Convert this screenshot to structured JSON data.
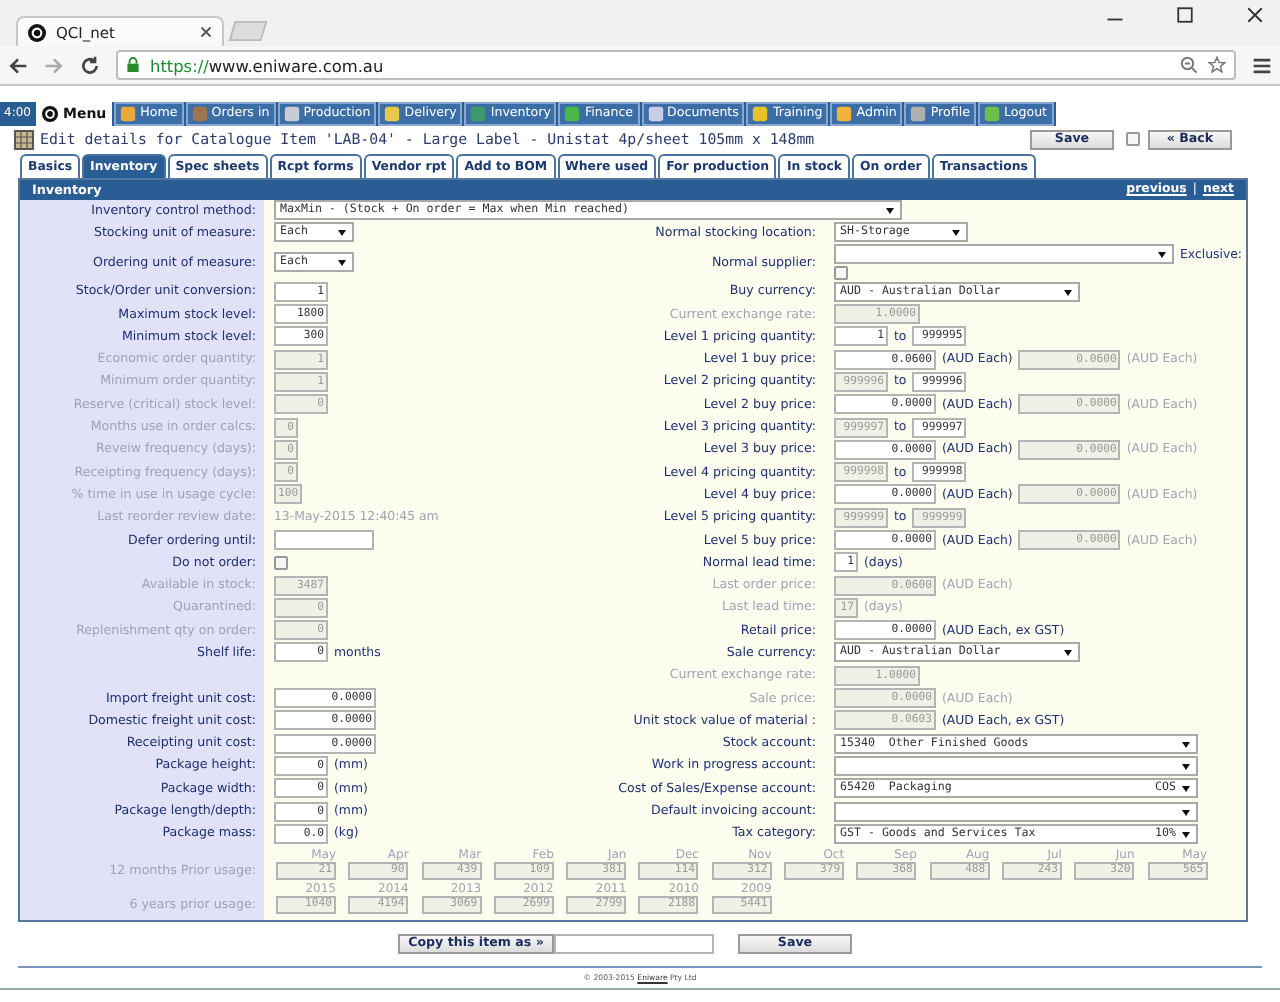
{
  "browser": {
    "tab_title": "QCI_net",
    "url_scheme": "https://",
    "url_host": "www.eniware.com.au"
  },
  "nav": {
    "clock": "4:00",
    "items": [
      {
        "label": "Menu",
        "kind": "menu"
      },
      {
        "label": "Home",
        "kind": "link"
      },
      {
        "label": "Orders in",
        "kind": "link"
      },
      {
        "label": "Production",
        "kind": "link"
      },
      {
        "label": "Delivery",
        "kind": "link"
      },
      {
        "label": "Inventory",
        "kind": "link"
      },
      {
        "label": "Finance",
        "kind": "link"
      },
      {
        "label": "Documents",
        "kind": "link"
      },
      {
        "label": "Training",
        "kind": "link"
      },
      {
        "label": "Admin",
        "kind": "link"
      },
      {
        "label": "Profile",
        "kind": "link"
      },
      {
        "label": "Logout",
        "kind": "link"
      }
    ]
  },
  "title": {
    "text": "Edit details for Catalogue Item 'LAB-04' - Large Label - Unistat 4p/sheet 105mm x 148mm",
    "save_button": "Save",
    "checked": false,
    "back_button": "« Back"
  },
  "tabs": [
    {
      "label": "Basics",
      "selected": false
    },
    {
      "label": "Inventory",
      "selected": true
    },
    {
      "label": "Spec sheets",
      "selected": false
    },
    {
      "label": "Rcpt forms",
      "selected": false
    },
    {
      "label": "Vendor rpt",
      "selected": false
    },
    {
      "label": "Add to BOM",
      "selected": false
    },
    {
      "label": "Where used",
      "selected": false
    },
    {
      "label": "For production",
      "selected": false
    },
    {
      "label": "In stock",
      "selected": false
    },
    {
      "label": "On order",
      "selected": false
    },
    {
      "label": "Transactions",
      "selected": false
    }
  ],
  "section": {
    "title": "Inventory",
    "links": [
      "previous",
      "next"
    ],
    "separator": "|"
  },
  "rows": [
    {
      "left": {
        "label": "Inventory control method:",
        "disabled": false,
        "parts": [
          {
            "kind": "method-select",
            "value": "MaxMin - (Stock + On order = Max when Min reached)"
          }
        ]
      }
    },
    {
      "left": {
        "label": "Stocking unit of measure:",
        "disabled": false,
        "parts": [
          {
            "kind": "unit-select",
            "value": "Each"
          }
        ]
      },
      "right": {
        "label": "Normal stocking location:",
        "disabled": false,
        "parts": [
          {
            "kind": "location-select",
            "value": "SH-Storage"
          }
        ]
      }
    },
    {
      "left": {
        "label": "Ordering unit of measure:",
        "disabled": false,
        "parts": [
          {
            "kind": "unit-select",
            "value": "Each"
          }
        ]
      },
      "right": {
        "label": "Normal supplier:",
        "disabled": false,
        "parts": [
          {
            "kind": "supplier-select"
          },
          {
            "kind": "note",
            "text": "Exclusive:",
            "disabled": false
          },
          {
            "kind": "checkbox",
            "checked": false
          }
        ]
      }
    },
    {
      "left": {
        "label": "Stock/Order unit conversion:",
        "disabled": false,
        "parts": [
          {
            "kind": "count",
            "value": "1",
            "disabled": false
          }
        ]
      },
      "right": {
        "label": "Buy currency:",
        "disabled": false,
        "parts": [
          {
            "kind": "currency-select",
            "value": "AUD - Australian Dollar"
          }
        ]
      }
    },
    {
      "left": {
        "label": "Maximum stock level:",
        "disabled": false,
        "parts": [
          {
            "kind": "count",
            "value": "1800",
            "disabled": false
          }
        ]
      },
      "right": {
        "label": "Current exchange rate:",
        "disabled": true,
        "parts": [
          {
            "kind": "rate",
            "value": "1.0000",
            "disabled": true
          }
        ]
      }
    },
    {
      "left": {
        "label": "Minimum stock level:",
        "disabled": false,
        "parts": [
          {
            "kind": "count",
            "value": "300",
            "disabled": false
          }
        ]
      },
      "right": {
        "label": "Level 1 pricing quantity:",
        "disabled": false,
        "parts": [
          {
            "kind": "qty",
            "value": "1",
            "disabled": false
          },
          {
            "kind": "note",
            "text": "to",
            "disabled": false
          },
          {
            "kind": "qty",
            "value": "999995",
            "disabled": false
          }
        ]
      }
    },
    {
      "left": {
        "label": "Economic order quantity:",
        "disabled": true,
        "parts": [
          {
            "kind": "count",
            "value": "1",
            "disabled": true
          }
        ]
      },
      "right": {
        "label": "Level 1 buy price:",
        "disabled": false,
        "parts": [
          {
            "kind": "amount",
            "value": "0.0600",
            "disabled": false
          },
          {
            "kind": "note",
            "text": "(AUD Each)",
            "disabled": false
          },
          {
            "kind": "amount",
            "value": "0.0600",
            "disabled": true
          },
          {
            "kind": "note",
            "text": "(AUD Each)",
            "disabled": true
          }
        ]
      }
    },
    {
      "left": {
        "label": "Minimum order quantity:",
        "disabled": true,
        "parts": [
          {
            "kind": "count",
            "value": "1",
            "disabled": true
          }
        ]
      },
      "right": {
        "label": "Level 2 pricing quantity:",
        "disabled": false,
        "parts": [
          {
            "kind": "qty",
            "value": "999996",
            "disabled": true
          },
          {
            "kind": "note",
            "text": "to",
            "disabled": false
          },
          {
            "kind": "qty",
            "value": "999996",
            "disabled": false
          }
        ]
      }
    },
    {
      "left": {
        "label": "Reserve (critical) stock level:",
        "disabled": true,
        "parts": [
          {
            "kind": "count",
            "value": "0",
            "disabled": true
          }
        ]
      },
      "right": {
        "label": "Level 2 buy price:",
        "disabled": false,
        "parts": [
          {
            "kind": "amount",
            "value": "0.0000",
            "disabled": false
          },
          {
            "kind": "note",
            "text": "(AUD Each)",
            "disabled": false
          },
          {
            "kind": "amount",
            "value": "0.0000",
            "disabled": true
          },
          {
            "kind": "note",
            "text": "(AUD Each)",
            "disabled": true
          }
        ]
      }
    },
    {
      "left": {
        "label": "Months use in order calcs:",
        "disabled": true,
        "parts": [
          {
            "kind": "tiny",
            "value": "0",
            "disabled": true
          }
        ]
      },
      "right": {
        "label": "Level 3 pricing quantity:",
        "disabled": false,
        "parts": [
          {
            "kind": "qty",
            "value": "999997",
            "disabled": true
          },
          {
            "kind": "note",
            "text": "to",
            "disabled": false
          },
          {
            "kind": "qty",
            "value": "999997",
            "disabled": false
          }
        ]
      }
    },
    {
      "left": {
        "label": "Reveiw frequency (days):",
        "disabled": true,
        "parts": [
          {
            "kind": "tiny",
            "value": "0",
            "disabled": true
          }
        ]
      },
      "right": {
        "label": "Level 3 buy price:",
        "disabled": false,
        "parts": [
          {
            "kind": "amount",
            "value": "0.0000",
            "disabled": false
          },
          {
            "kind": "note",
            "text": "(AUD Each)",
            "disabled": false
          },
          {
            "kind": "amount",
            "value": "0.0000",
            "disabled": true
          },
          {
            "kind": "note",
            "text": "(AUD Each)",
            "disabled": true
          }
        ]
      }
    },
    {
      "left": {
        "label": "Receipting frequency (days):",
        "disabled": true,
        "parts": [
          {
            "kind": "tiny",
            "value": "0",
            "disabled": true
          }
        ]
      },
      "right": {
        "label": "Level 4 pricing quantity:",
        "disabled": false,
        "parts": [
          {
            "kind": "qty",
            "value": "999998",
            "disabled": true
          },
          {
            "kind": "note",
            "text": "to",
            "disabled": false
          },
          {
            "kind": "qty",
            "value": "999998",
            "disabled": false
          }
        ]
      }
    },
    {
      "left": {
        "label": "% time in use in usage cycle:",
        "disabled": true,
        "parts": [
          {
            "kind": "small",
            "value": "100",
            "disabled": true
          }
        ]
      },
      "right": {
        "label": "Level 4 buy price:",
        "disabled": false,
        "parts": [
          {
            "kind": "amount",
            "value": "0.0000",
            "disabled": false
          },
          {
            "kind": "note",
            "text": "(AUD Each)",
            "disabled": false
          },
          {
            "kind": "amount",
            "value": "0.0000",
            "disabled": true
          },
          {
            "kind": "note",
            "text": "(AUD Each)",
            "disabled": true
          }
        ]
      }
    },
    {
      "left": {
        "label": "Last reorder review date:",
        "disabled": true,
        "parts": [
          {
            "kind": "static",
            "text": "13-May-2015 12:40:45 am",
            "disabled": true
          }
        ]
      },
      "right": {
        "label": "Level 5 pricing quantity:",
        "disabled": false,
        "parts": [
          {
            "kind": "qty",
            "value": "999999",
            "disabled": true
          },
          {
            "kind": "note",
            "text": "to",
            "disabled": false
          },
          {
            "kind": "qty",
            "value": "999999",
            "disabled": true
          }
        ]
      }
    },
    {
      "left": {
        "label": "Defer ordering until:",
        "disabled": false,
        "parts": [
          {
            "kind": "date",
            "disabled": false
          }
        ]
      },
      "right": {
        "label": "Level 5 buy price:",
        "disabled": false,
        "parts": [
          {
            "kind": "amount",
            "value": "0.0000",
            "disabled": false
          },
          {
            "kind": "note",
            "text": "(AUD Each)",
            "disabled": false
          },
          {
            "kind": "amount",
            "value": "0.0000",
            "disabled": true
          },
          {
            "kind": "note",
            "text": "(AUD Each)",
            "disabled": true
          }
        ]
      }
    },
    {
      "left": {
        "label": "Do not order:",
        "disabled": false,
        "parts": [
          {
            "kind": "checkbox",
            "checked": false
          }
        ]
      },
      "right": {
        "label": "Normal lead time:",
        "disabled": false,
        "parts": [
          {
            "kind": "tiny",
            "value": "1",
            "disabled": false
          },
          {
            "kind": "note",
            "text": "(days)",
            "disabled": false
          }
        ]
      }
    },
    {
      "left": {
        "label": "Available in stock:",
        "disabled": true,
        "parts": [
          {
            "kind": "count",
            "value": "3487",
            "disabled": true
          }
        ]
      },
      "right": {
        "label": "Last order price:",
        "disabled": true,
        "parts": [
          {
            "kind": "amount",
            "value": "0.0600",
            "disabled": true
          },
          {
            "kind": "note",
            "text": "(AUD Each)",
            "disabled": true
          }
        ]
      }
    },
    {
      "left": {
        "label": "Quarantined:",
        "disabled": true,
        "parts": [
          {
            "kind": "count",
            "value": "0",
            "disabled": true
          }
        ]
      },
      "right": {
        "label": "Last lead time:",
        "disabled": true,
        "parts": [
          {
            "kind": "tiny",
            "value": "17",
            "disabled": true
          },
          {
            "kind": "note",
            "text": "(days)",
            "disabled": true
          }
        ]
      }
    },
    {
      "left": {
        "label": "Replenishment qty on order:",
        "disabled": true,
        "parts": [
          {
            "kind": "count",
            "value": "0",
            "disabled": true
          }
        ]
      },
      "right": {
        "label": "Retail price:",
        "disabled": false,
        "parts": [
          {
            "kind": "amount",
            "value": "0.0000",
            "disabled": false
          },
          {
            "kind": "note",
            "text": "(AUD Each, ex GST)",
            "disabled": false
          }
        ]
      }
    },
    {
      "left": {
        "label": "Shelf life:",
        "disabled": false,
        "parts": [
          {
            "kind": "count",
            "value": "0",
            "disabled": false
          },
          {
            "kind": "note",
            "text": "months",
            "disabled": false
          }
        ]
      },
      "right": {
        "label": "Sale currency:",
        "disabled": false,
        "parts": [
          {
            "kind": "currency-select",
            "value": "AUD - Australian Dollar"
          }
        ]
      }
    },
    {
      "right": {
        "label": "Current exchange rate:",
        "disabled": true,
        "parts": [
          {
            "kind": "rate",
            "value": "1.0000",
            "disabled": true
          }
        ]
      }
    },
    {
      "left": {
        "label": "Import freight unit cost:",
        "disabled": false,
        "parts": [
          {
            "kind": "amount",
            "value": "0.0000",
            "disabled": false
          }
        ]
      },
      "right": {
        "label": "Sale price:",
        "disabled": true,
        "parts": [
          {
            "kind": "amount",
            "value": "0.0000",
            "disabled": true
          },
          {
            "kind": "note",
            "text": "(AUD Each)",
            "disabled": true
          }
        ]
      }
    },
    {
      "left": {
        "label": "Domestic freight unit cost:",
        "disabled": false,
        "parts": [
          {
            "kind": "amount",
            "value": "0.0000",
            "disabled": false
          }
        ]
      },
      "right": {
        "label": "Unit stock value of material :",
        "disabled": false,
        "parts": [
          {
            "kind": "amount",
            "value": "0.0603",
            "disabled": true
          },
          {
            "kind": "note",
            "text": "(AUD Each, ex GST)",
            "disabled": false
          }
        ]
      }
    },
    {
      "left": {
        "label": "Receipting unit cost:",
        "disabled": false,
        "parts": [
          {
            "kind": "amount",
            "value": "0.0000",
            "disabled": false
          }
        ]
      },
      "right": {
        "label": "Stock account:",
        "disabled": false,
        "parts": [
          {
            "kind": "account-select",
            "value": "15340  Other Finished Goods"
          }
        ]
      }
    },
    {
      "left": {
        "label": "Package height:",
        "disabled": false,
        "parts": [
          {
            "kind": "count",
            "value": "0",
            "disabled": false
          },
          {
            "kind": "note",
            "text": "(mm)",
            "disabled": false
          }
        ]
      },
      "right": {
        "label": "Work in progress account:",
        "disabled": false,
        "parts": [
          {
            "kind": "account-select"
          }
        ]
      }
    },
    {
      "left": {
        "label": "Package width:",
        "disabled": false,
        "parts": [
          {
            "kind": "count",
            "value": "0",
            "disabled": false
          },
          {
            "kind": "note",
            "text": "(mm)",
            "disabled": false
          }
        ]
      },
      "right": {
        "label": "Cost of Sales/Expense account:",
        "disabled": false,
        "parts": [
          {
            "kind": "account-select",
            "value": "65420  Packaging",
            "code": "COS"
          }
        ]
      }
    },
    {
      "left": {
        "label": "Package length/depth:",
        "disabled": false,
        "parts": [
          {
            "kind": "count",
            "value": "0",
            "disabled": false
          },
          {
            "kind": "note",
            "text": "(mm)",
            "disabled": false
          }
        ]
      },
      "right": {
        "label": "Default invoicing account:",
        "disabled": false,
        "parts": [
          {
            "kind": "account-select"
          }
        ]
      }
    },
    {
      "left": {
        "label": "Package mass:",
        "disabled": false,
        "parts": [
          {
            "kind": "count",
            "value": "0.0",
            "disabled": false
          },
          {
            "kind": "note",
            "text": "(kg)",
            "disabled": false
          }
        ]
      },
      "right": {
        "label": "Tax category:",
        "disabled": false,
        "parts": [
          {
            "kind": "account-select",
            "value": "GST - Goods and Services Tax",
            "code": "10%"
          }
        ]
      }
    }
  ],
  "usage": [
    {
      "label": "12 months Prior usage:",
      "disabled": true,
      "columns": [
        {
          "heading": "May",
          "value": "21"
        },
        {
          "heading": "Apr",
          "value": "90"
        },
        {
          "heading": "Mar",
          "value": "439"
        },
        {
          "heading": "Feb",
          "value": "109"
        },
        {
          "heading": "Jan",
          "value": "381"
        },
        {
          "heading": "Dec",
          "value": "114"
        },
        {
          "heading": "Nov",
          "value": "312"
        },
        {
          "heading": "Oct",
          "value": "379"
        },
        {
          "heading": "Sep",
          "value": "368"
        },
        {
          "heading": "Aug",
          "value": "488"
        },
        {
          "heading": "Jul",
          "value": "243"
        },
        {
          "heading": "Jun",
          "value": "320"
        },
        {
          "heading": "May",
          "value": "565"
        }
      ]
    },
    {
      "label": "6 years prior usage:",
      "disabled": true,
      "columns": [
        {
          "heading": "2015",
          "value": "1040"
        },
        {
          "heading": "2014",
          "value": "4194"
        },
        {
          "heading": "2013",
          "value": "3069"
        },
        {
          "heading": "2012",
          "value": "2699"
        },
        {
          "heading": "2011",
          "value": "2799"
        },
        {
          "heading": "2010",
          "value": "2188"
        },
        {
          "heading": "2009",
          "value": "5441"
        }
      ]
    }
  ],
  "footer": {
    "copy_button": "Copy this item as »",
    "save_button": "Save",
    "copyright_before": "© 2003-2015",
    "link": "Eniware",
    "copyright_after": "Pty Ltd"
  }
}
